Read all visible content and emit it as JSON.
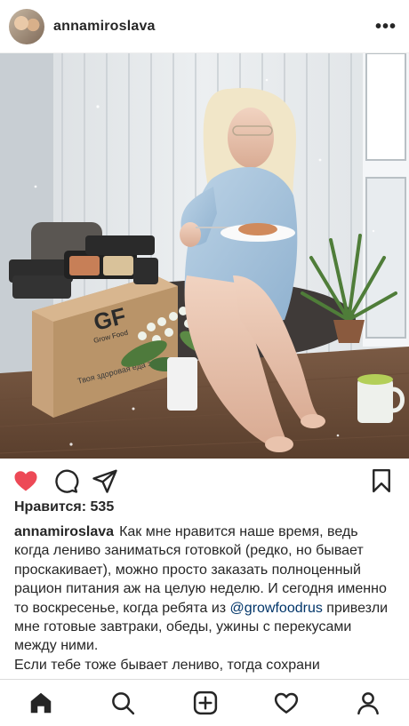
{
  "post": {
    "username": "annamiroslava",
    "more_label": "•••",
    "photo": {
      "box_text": "GF",
      "box_brand": "Grow Food",
      "box_slogan": "Твоя здоровая еда здесь"
    }
  },
  "actions": {
    "like_icon": "heart-filled-icon",
    "comment_icon": "comment-icon",
    "share_icon": "share-icon",
    "save_icon": "bookmark-icon",
    "like_color": "#ed4956"
  },
  "likes_text": "Нравится: 535",
  "caption": {
    "username": "annamiroslava",
    "text_before_mention": "Как мне нравится наше время, ведь когда лениво заниматься готовкой (редко, но бывает проскакивает), можно просто заказать полноценный рацион питания аж на целую неделю. И сегодня именно то воскресенье, когда ребята из ",
    "mention": "@growfoodrus",
    "text_after_mention": " привезли мне готовые завтраки, обеды, ужины с перекусами между ними.",
    "next_line": "Если тебе тоже бывает лениво, тогда сохрани"
  },
  "nav": {
    "home": "home-icon",
    "search": "search-icon",
    "add": "add-post-icon",
    "activity": "activity-heart-icon",
    "profile": "profile-icon"
  }
}
